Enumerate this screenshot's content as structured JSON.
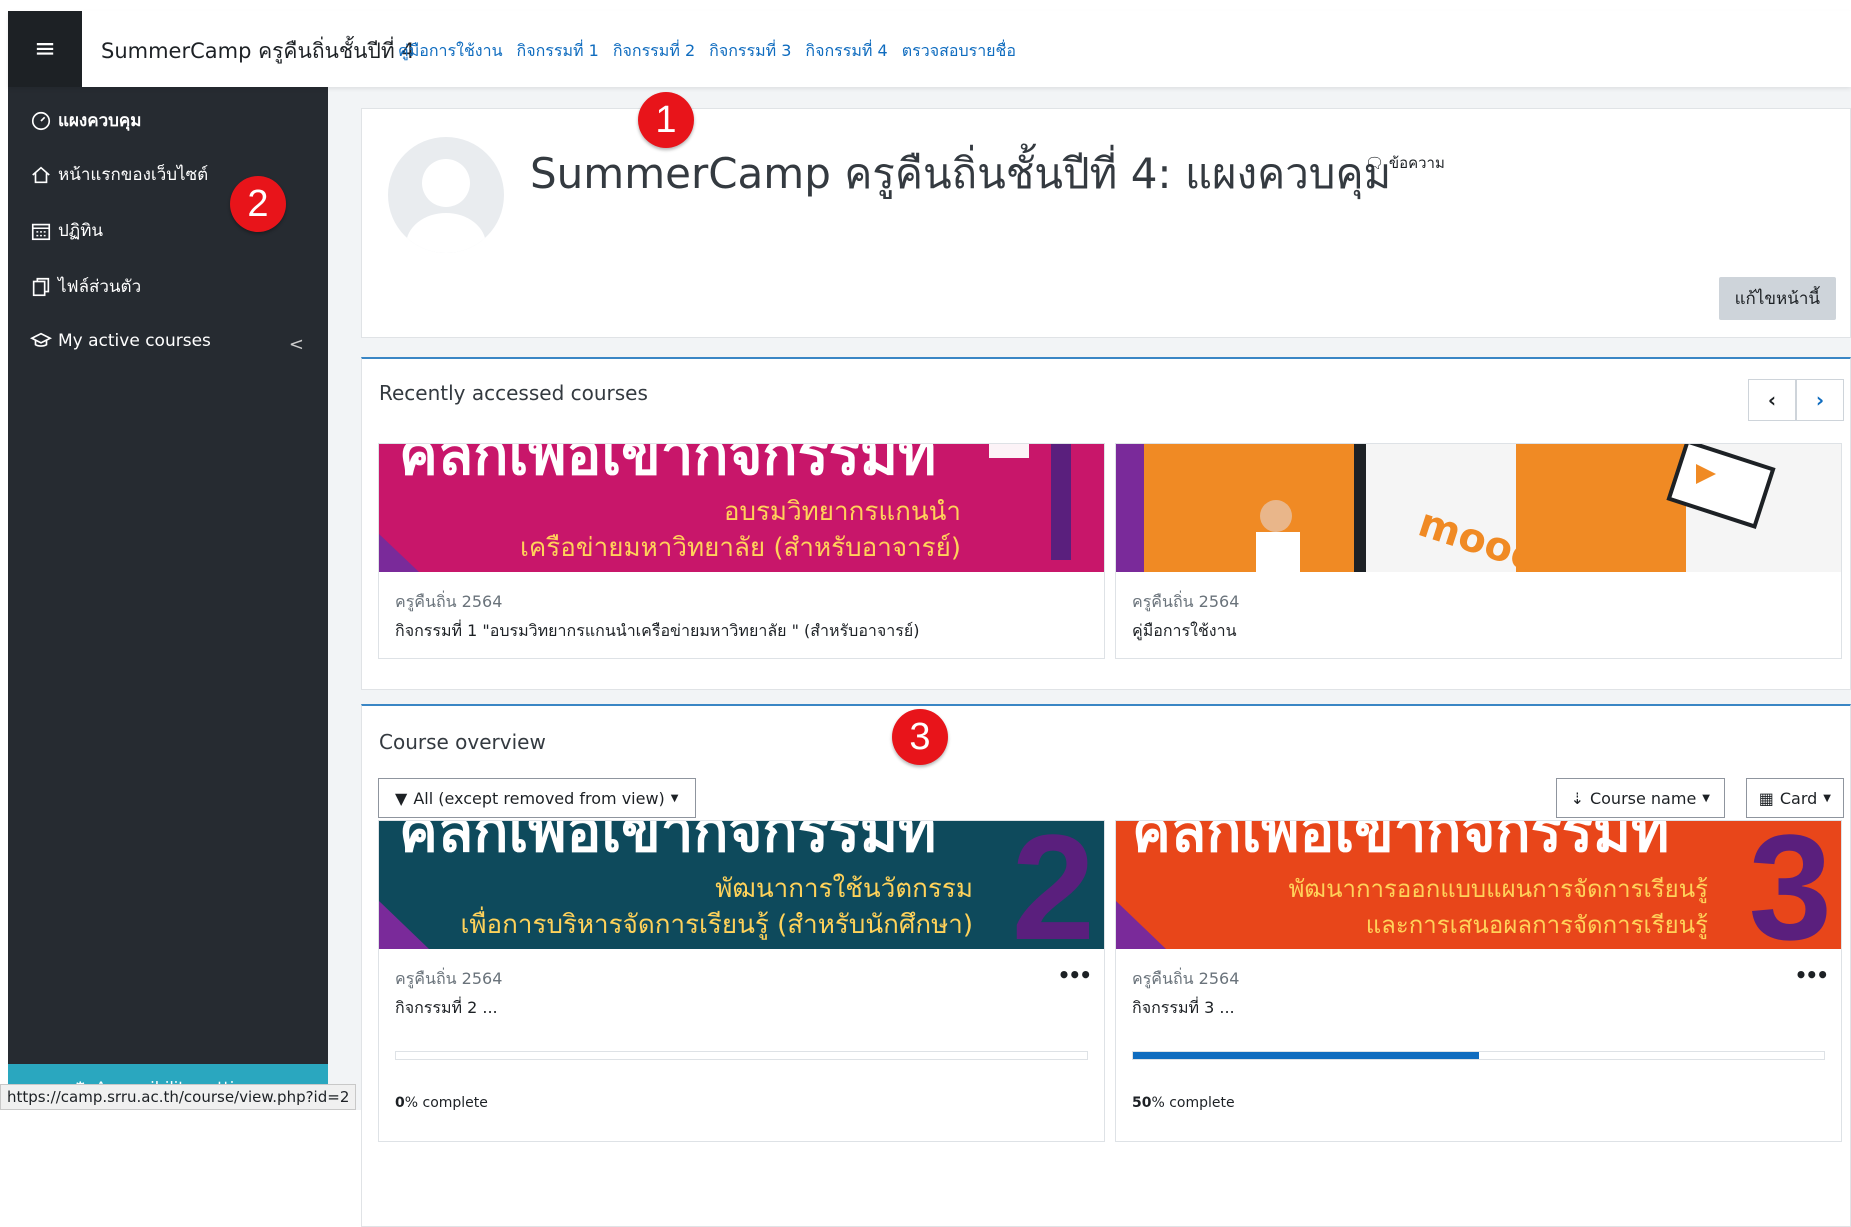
{
  "navbar": {
    "brand": "SummerCamp ครูคืนถิ่นชั้นปีที่ 4",
    "links": [
      "คู่มือการใช้งาน",
      "กิจกรรมที่ 1",
      "กิจกรรมที่ 2",
      "กิจกรรมที่ 3",
      "กิจกรรมที่ 4",
      "ตรวจสอบรายชื่อ"
    ]
  },
  "sidebar": {
    "items": [
      {
        "label": "แผงควบคุม",
        "icon": "dashboard-icon"
      },
      {
        "label": "หน้าแรกของเว็บไซต์",
        "icon": "home-icon"
      },
      {
        "label": "ปฏิทิน",
        "icon": "calendar-icon"
      },
      {
        "label": "ไฟล์ส่วนตัว",
        "icon": "files-icon"
      },
      {
        "label": "My active courses",
        "icon": "graduation-cap-icon"
      }
    ],
    "accessibility": "Accessibility settings"
  },
  "header": {
    "title": "SummerCamp ครูคืนถิ่นชั้นปีที่ 4: แผงควบคุม",
    "message_link": "ข้อความ",
    "edit_button": "แก้ไขหน้านี้"
  },
  "recent": {
    "title": "Recently accessed courses",
    "courses": [
      {
        "category": "ครูคืนถิ่น 2564",
        "name": "กิจกรรมที่ 1 \"อบรมวิทยากรแกนนำเครือข่ายมหาวิทยาลัย \" (สำหรับอาจารย์)",
        "banner_line1": "อบรมวิทยากรแกนนำ",
        "banner_line2": "เครือข่ายมหาวิทยาลัย (สำหรับอาจารย์)",
        "banner_number": "1",
        "banner_color": "#c8166a"
      },
      {
        "category": "ครูคืนถิ่น 2564",
        "name": "คู่มือการใช้งาน",
        "banner_word": "moodle",
        "banner_color": "#f08a24"
      }
    ]
  },
  "overview": {
    "title": "Course overview",
    "filter": "All (except removed from view)",
    "sort": "Course name",
    "view": "Card",
    "courses": [
      {
        "category": "ครูคืนถิ่น 2564",
        "name": "กิจกรรมที่ 2 ...",
        "banner_line1": "พัฒนาการใช้นวัตกรรม",
        "banner_line2": "เพื่อการบริหารจัดการเรียนรู้ (สำหรับนักศึกษา)",
        "banner_number": "2",
        "banner_color": "#0e4a5c",
        "progress": 0,
        "progress_pct": "0",
        "progress_label": "% complete"
      },
      {
        "category": "ครูคืนถิ่น 2564",
        "name": "กิจกรรมที่ 3 ...",
        "banner_line1": "พัฒนาการออกแบบแผนการจัดการเรียนรู้",
        "banner_line2": "และการเสนอผลการจัดการเรียนรู้",
        "banner_number": "3",
        "banner_color": "#e8461a",
        "progress": 0.5,
        "progress_pct": "50",
        "progress_label": "% complete"
      }
    ]
  },
  "badges": [
    "1",
    "2",
    "3"
  ],
  "status_url": "https://camp.srru.ac.th/course/view.php?id=2",
  "colors": {
    "sidebar": "#262b31",
    "link": "#0f6cbf",
    "badge": "#e8141a",
    "accessibility": "#2aa7bf"
  }
}
